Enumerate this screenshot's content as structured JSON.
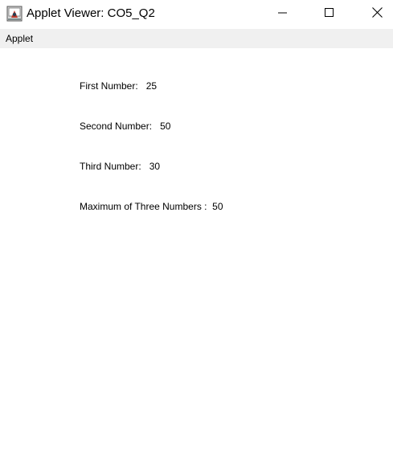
{
  "window": {
    "title": "Applet Viewer: CO5_Q2",
    "icon": "java-applet-icon",
    "controls": {
      "minimize_icon": "minimize-icon",
      "maximize_icon": "maximize-icon",
      "close_icon": "close-icon"
    }
  },
  "menubar": {
    "items": [
      {
        "label": "Applet"
      }
    ]
  },
  "applet": {
    "lines": [
      {
        "label": "First Number:",
        "value": "25"
      },
      {
        "label": "Second Number:",
        "value": "50"
      },
      {
        "label": "Third Number:",
        "value": "30"
      },
      {
        "label": "Maximum of Three Numbers :",
        "value": "50"
      }
    ]
  }
}
